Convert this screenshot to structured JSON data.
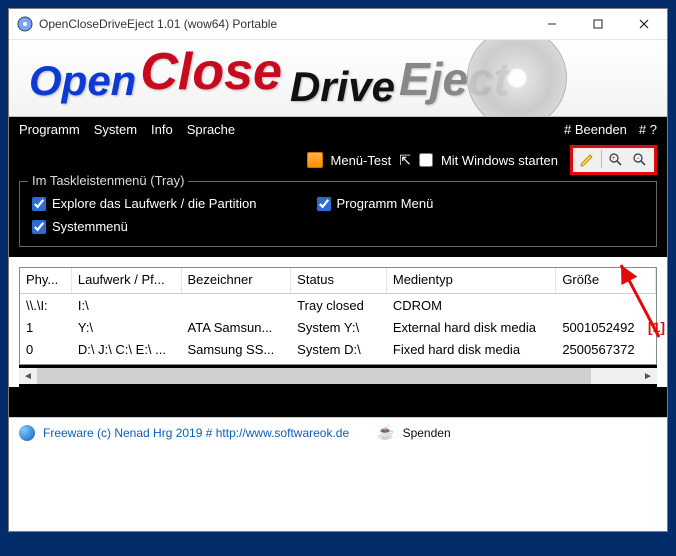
{
  "window": {
    "title": "OpenCloseDriveEject 1.01  (wow64)  Portable"
  },
  "banner": {
    "open": "Open",
    "close": "Close",
    "drive": "Drive",
    "eject": "Eject"
  },
  "menu": {
    "programm": "Programm",
    "system": "System",
    "info": "Info",
    "sprache": "Sprache",
    "beenden": "# Beenden",
    "help": "# ?"
  },
  "toolbar": {
    "menu_test": "Menü-Test",
    "mit_windows": "Mit Windows starten"
  },
  "tray_group": {
    "legend": "Im Taskleistenmenü (Tray)",
    "explore": "Explore das Laufwerk / die Partition",
    "systemmenu": "Systemmenü",
    "programm_menu": "Programm Menü"
  },
  "table": {
    "headers": [
      "Phy...",
      "Laufwerk / Pf...",
      "Bezeichner",
      "Status",
      "Medientyp",
      "Größe"
    ],
    "rows": [
      [
        "\\\\.\\I:",
        "I:\\",
        "",
        "Tray closed",
        "CDROM",
        ""
      ],
      [
        "1",
        "Y:\\",
        "ATA Samsun...",
        "System Y:\\",
        "External hard disk media",
        "5001052492"
      ],
      [
        "0",
        "D:\\ J:\\ C:\\ E:\\ ...",
        "Samsung SS...",
        "System D:\\",
        "Fixed hard disk media",
        "2500567372"
      ]
    ]
  },
  "footer": {
    "freeware": "Freeware (c) Nenad Hrg 2019 # http://www.softwareok.de",
    "spenden": "Spenden"
  },
  "annotation": {
    "label": "[1]"
  }
}
